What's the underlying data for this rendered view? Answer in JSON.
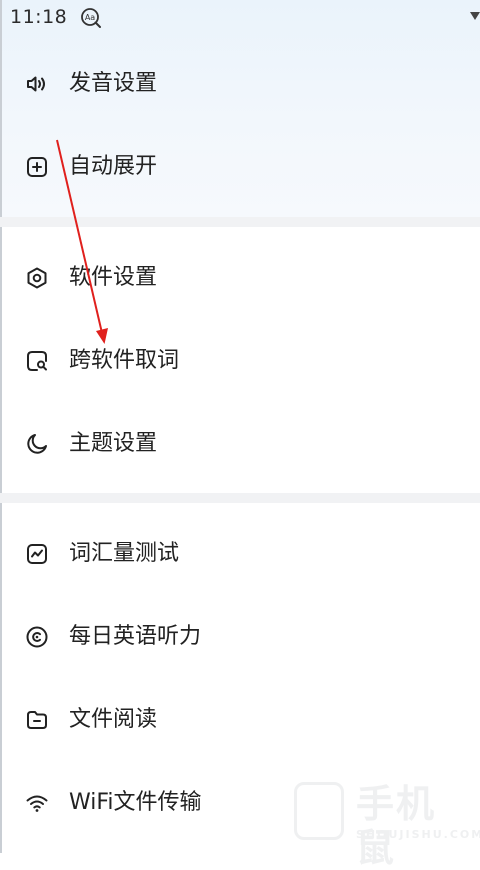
{
  "status_bar": {
    "time": "11:18",
    "app_icon": "Aa"
  },
  "menu": {
    "items": [
      {
        "label": "发音设置",
        "icon": "speaker-icon"
      },
      {
        "label": "自动展开",
        "icon": "plus-square-icon"
      },
      {
        "label": "软件设置",
        "icon": "hexagon-settings-icon"
      },
      {
        "label": "跨软件取词",
        "icon": "search-square-icon"
      },
      {
        "label": "主题设置",
        "icon": "moon-icon"
      },
      {
        "label": "词汇量测试",
        "icon": "chart-line-icon"
      },
      {
        "label": "每日英语听力",
        "icon": "listening-icon"
      },
      {
        "label": "文件阅读",
        "icon": "folder-icon"
      },
      {
        "label": "WiFi文件传输",
        "icon": "wifi-icon"
      }
    ]
  },
  "watermark": {
    "text": "手机鼠",
    "subtext": "SHOUJISHU.COM"
  },
  "colors": {
    "arrow": "#e0201d",
    "header_gradient": "#eaf3fb",
    "divider": "#f1f2f4"
  }
}
